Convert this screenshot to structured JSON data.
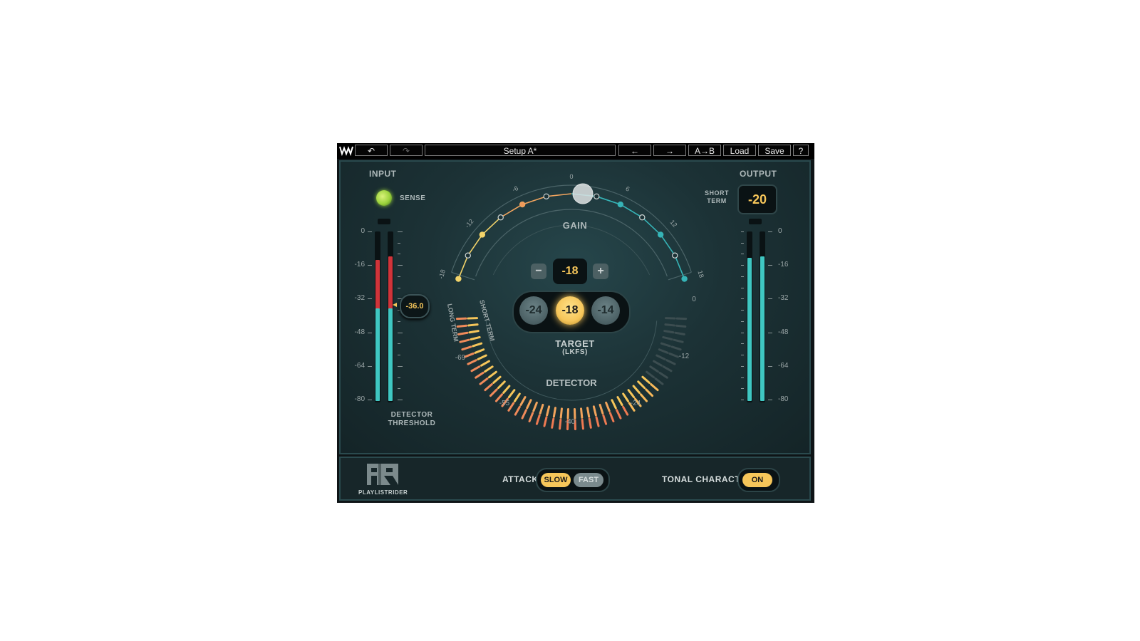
{
  "toolbar": {
    "undo_icon": "undo-icon",
    "redo_icon": "redo-icon",
    "setup_name": "Setup A*",
    "prev_icon": "arrow-left-icon",
    "next_icon": "arrow-right-icon",
    "ab_label": "A→B",
    "load_label": "Load",
    "save_label": "Save",
    "help_label": "?"
  },
  "input": {
    "title": "INPUT",
    "sense_label": "SENSE",
    "scale": [
      "0",
      "-16",
      "-32",
      "-48",
      "-64",
      "-80"
    ],
    "threshold_value": "-36.0",
    "threshold_label_1": "DETECTOR",
    "threshold_label_2": "THRESHOLD",
    "meter_left_level": 0.55,
    "meter_right_level": 0.55,
    "peak_left": 0.84,
    "peak_right": 0.86
  },
  "output": {
    "title": "OUTPUT",
    "short_term_1": "SHORT",
    "short_term_2": "TERM",
    "short_term_value": "-20",
    "scale": [
      "0",
      "-16",
      "-32",
      "-48",
      "-64",
      "-80"
    ],
    "meter_left_level": 0.85,
    "meter_right_level": 0.86
  },
  "gain": {
    "label": "GAIN",
    "scale": [
      "-18",
      "-12",
      "-6",
      "0",
      "6",
      "12",
      "18"
    ],
    "value": 0.5
  },
  "target": {
    "minus": "−",
    "plus": "+",
    "value": "-18",
    "presets": [
      "-24",
      "-18",
      "-14"
    ],
    "selected": "-18",
    "label": "TARGET",
    "unit": "(LKFS)"
  },
  "detector": {
    "label": "DETECTOR",
    "long_term": "LONG TERM",
    "short_term": "SHORT TERM",
    "scale": [
      "-69",
      "-55",
      "-40",
      "-24",
      "-12",
      "0"
    ]
  },
  "footer": {
    "brand": "PLAYLISTRIDER",
    "attack_label": "ATTACK",
    "attack_slow": "SLOW",
    "attack_fast": "FAST",
    "attack_selected": "SLOW",
    "tonal_label": "TONAL CHARACTER",
    "tonal_value": "ON"
  },
  "colors": {
    "accent": "#f6c65a",
    "meter_cyan": "#3fc7c2",
    "meter_red": "#d0343a",
    "sense_green": "#9bd23c"
  }
}
